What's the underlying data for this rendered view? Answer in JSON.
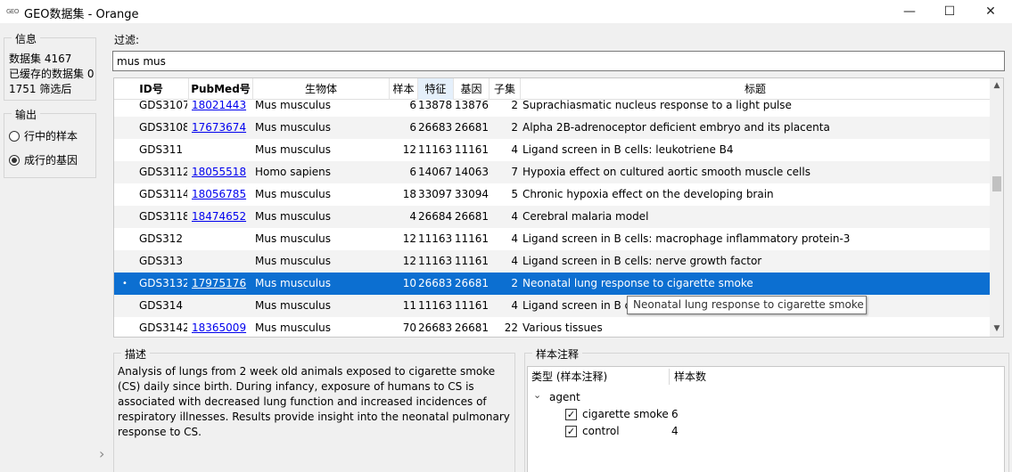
{
  "window": {
    "app_icon": "GEO",
    "title": "GEO数据集 - Orange",
    "minimize": "—",
    "maximize": "☐",
    "close": "✕"
  },
  "info": {
    "title": "信息",
    "datasets": "数据集 4167",
    "cached": "已缓存的数据集 0",
    "filtered": "1751 筛选后"
  },
  "output": {
    "title": "输出",
    "options": [
      {
        "label": "行中的样本",
        "checked": false
      },
      {
        "label": "成行的基因",
        "checked": true
      }
    ]
  },
  "filter": {
    "label": "过滤:",
    "value": "mus mus"
  },
  "table": {
    "columns": [
      "ID号",
      "PubMed号",
      "生物体",
      "样本",
      "特征",
      "基因",
      "子集",
      "标题"
    ],
    "sorted_column": 4,
    "rows": [
      {
        "id": "GDS3107",
        "pubmed": "18021443",
        "organism": "Mus musculus",
        "samples": "6",
        "features": "13878",
        "genes": "13876",
        "subsets": "2",
        "title": "Suprachiasmatic nucleus response to a light pulse"
      },
      {
        "id": "GDS3108",
        "pubmed": "17673674",
        "organism": "Mus musculus",
        "samples": "6",
        "features": "26683",
        "genes": "26681",
        "subsets": "2",
        "title": "Alpha 2B-adrenoceptor deficient embryo and its placenta"
      },
      {
        "id": "GDS311",
        "pubmed": "",
        "organism": "Mus musculus",
        "samples": "12",
        "features": "11163",
        "genes": "11161",
        "subsets": "4",
        "title": "Ligand screen in B cells: leukotriene B4"
      },
      {
        "id": "GDS3112",
        "pubmed": "18055518",
        "organism": "Homo sapiens",
        "samples": "6",
        "features": "14067",
        "genes": "14063",
        "subsets": "7",
        "title": "Hypoxia effect on cultured aortic smooth muscle cells"
      },
      {
        "id": "GDS3114",
        "pubmed": "18056785",
        "organism": "Mus musculus",
        "samples": "18",
        "features": "33097",
        "genes": "33094",
        "subsets": "5",
        "title": "Chronic hypoxia effect on the developing brain"
      },
      {
        "id": "GDS3118",
        "pubmed": "18474652",
        "organism": "Mus musculus",
        "samples": "4",
        "features": "26684",
        "genes": "26681",
        "subsets": "4",
        "title": "Cerebral malaria model"
      },
      {
        "id": "GDS312",
        "pubmed": "",
        "organism": "Mus musculus",
        "samples": "12",
        "features": "11163",
        "genes": "11161",
        "subsets": "4",
        "title": "Ligand screen in B cells: macrophage inflammatory protein-3"
      },
      {
        "id": "GDS313",
        "pubmed": "",
        "organism": "Mus musculus",
        "samples": "12",
        "features": "11163",
        "genes": "11161",
        "subsets": "4",
        "title": "Ligand screen in B cells: nerve growth factor"
      },
      {
        "id": "GDS3132",
        "pubmed": "17975176",
        "organism": "Mus musculus",
        "samples": "10",
        "features": "26683",
        "genes": "26681",
        "subsets": "2",
        "title": "Neonatal lung response to cigarette smoke",
        "selected": true,
        "marker": "•"
      },
      {
        "id": "GDS314",
        "pubmed": "",
        "organism": "Mus musculus",
        "samples": "11",
        "features": "11163",
        "genes": "11161",
        "subsets": "4",
        "title": "Ligand screen in B c"
      },
      {
        "id": "GDS3142",
        "pubmed": "18365009",
        "organism": "Mus musculus",
        "samples": "70",
        "features": "26683",
        "genes": "26681",
        "subsets": "22",
        "title": "Various tissues"
      }
    ],
    "tooltip": "Neonatal lung response to cigarette smoke",
    "scroll_up": "▲",
    "scroll_down": "▼"
  },
  "description": {
    "title": "描述",
    "text": "Analysis of lungs from 2 week old animals exposed to cigarette smoke (CS) daily since birth. During infancy, exposure of humans to CS is associated with decreased lung function and increased incidences of respiratory illnesses. Results provide insight into the neonatal pulmonary response to CS."
  },
  "expand_icon": "›",
  "annotations": {
    "title": "样本注释",
    "col_type": "类型 (样本注释)",
    "col_count": "样本数",
    "group": {
      "name": "agent",
      "expanded": true,
      "chevron": "⌄"
    },
    "items": [
      {
        "label": "cigarette smoke",
        "count": "6",
        "checked": true
      },
      {
        "label": "control",
        "count": "4",
        "checked": true
      }
    ],
    "check_mark": "✓"
  },
  "colors": {
    "selection": "#0c6fd1",
    "link": "#0000ee",
    "sorted_header": "#e5f0fb"
  }
}
